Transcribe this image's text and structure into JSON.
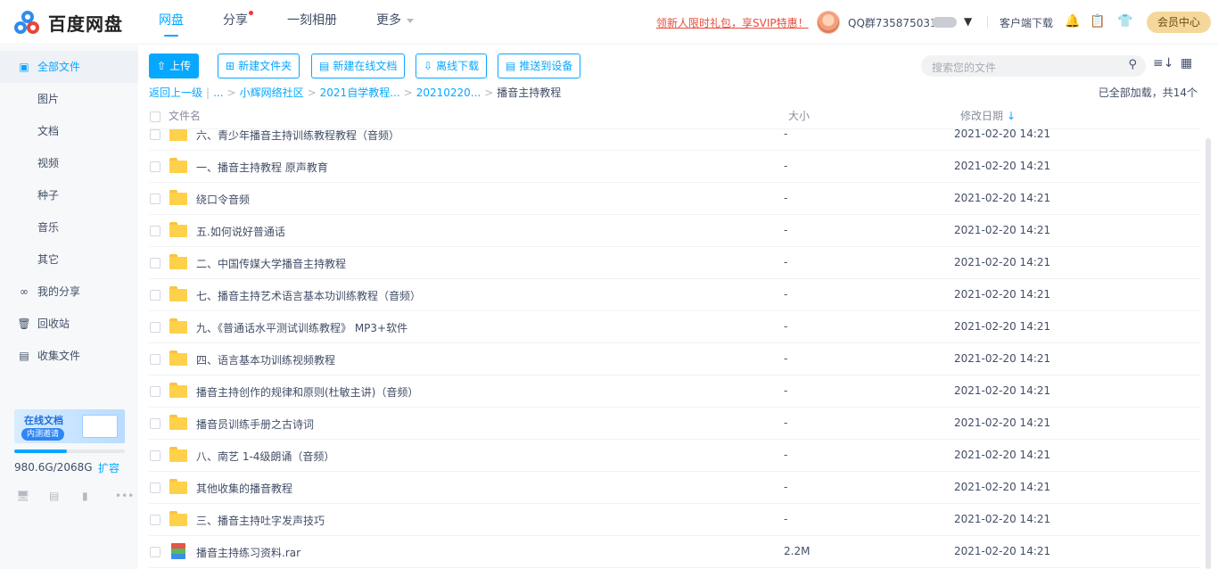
{
  "header": {
    "logo_text": "百度网盘",
    "nav": [
      {
        "label": "网盘",
        "active": true
      },
      {
        "label": "分享",
        "dot": true
      },
      {
        "label": "一刻相册"
      },
      {
        "label": "更多",
        "caret": true
      }
    ],
    "promo": "领新人限时礼包，享SVIP特惠！",
    "username": "QQ群735875031",
    "client_download": "客户端下载",
    "member_center": "会员中心"
  },
  "sidebar": {
    "items": [
      {
        "label": "全部文件",
        "icon": "file-icon",
        "active": true
      },
      {
        "label": "图片"
      },
      {
        "label": "文档"
      },
      {
        "label": "视频"
      },
      {
        "label": "种子"
      },
      {
        "label": "音乐"
      },
      {
        "label": "其它"
      },
      {
        "label": "我的分享",
        "icon": "share-icon"
      },
      {
        "label": "回收站",
        "icon": "trash-icon"
      },
      {
        "label": "收集文件",
        "icon": "collect-icon"
      }
    ],
    "banner": {
      "title": "在线文档",
      "badge": "内测邀请"
    },
    "quota": {
      "used_text": "980.6G/2068G",
      "used_fraction": 0.474,
      "expand": "扩容"
    }
  },
  "toolbar": {
    "upload": "上传",
    "new_folder": "新建文件夹",
    "new_doc": "新建在线文档",
    "offline_download": "离线下载",
    "push_device": "推送到设备",
    "search_placeholder": "搜索您的文件"
  },
  "breadcrumb": {
    "back": "返回上一级",
    "ellipsis": "...",
    "items": [
      "小辉网络社区",
      "2021自学教程...",
      "20210220..."
    ],
    "current": "播音主持教程"
  },
  "loaded_status": "已全部加载，共14个",
  "table": {
    "headers": {
      "name": "文件名",
      "size": "大小",
      "date": "修改日期"
    },
    "rows": [
      {
        "name": "六、青少年播音主持训练教程教程（音频）",
        "size": "-",
        "date": "2021-02-20 14:21",
        "type": "folder"
      },
      {
        "name": "一、播音主持教程 原声教育",
        "size": "-",
        "date": "2021-02-20 14:21",
        "type": "folder"
      },
      {
        "name": "绕口令音频",
        "size": "-",
        "date": "2021-02-20 14:21",
        "type": "folder"
      },
      {
        "name": "五.如何说好普通话",
        "size": "-",
        "date": "2021-02-20 14:21",
        "type": "folder"
      },
      {
        "name": "二、中国传媒大学播音主持教程",
        "size": "-",
        "date": "2021-02-20 14:21",
        "type": "folder"
      },
      {
        "name": "七、播音主持艺术语言基本功训练教程（音频）",
        "size": "-",
        "date": "2021-02-20 14:21",
        "type": "folder"
      },
      {
        "name": "九、《普通话水平测试训练教程》 MP3+软件",
        "size": "-",
        "date": "2021-02-20 14:21",
        "type": "folder"
      },
      {
        "name": "四、语言基本功训练视频教程",
        "size": "-",
        "date": "2021-02-20 14:21",
        "type": "folder"
      },
      {
        "name": "播音主持创作的规律和原则(杜敏主讲)（音频）",
        "size": "-",
        "date": "2021-02-20 14:21",
        "type": "folder"
      },
      {
        "name": "播音员训练手册之古诗词",
        "size": "-",
        "date": "2021-02-20 14:21",
        "type": "folder"
      },
      {
        "name": "八、南艺 1-4级朗诵（音频）",
        "size": "-",
        "date": "2021-02-20 14:21",
        "type": "folder"
      },
      {
        "name": "其他收集的播音教程",
        "size": "-",
        "date": "2021-02-20 14:21",
        "type": "folder"
      },
      {
        "name": "三、播音主持吐字发声技巧",
        "size": "-",
        "date": "2021-02-20 14:21",
        "type": "folder"
      },
      {
        "name": "播音主持练习资料.rar",
        "size": "2.2M",
        "date": "2021-02-20 14:21",
        "type": "rar"
      }
    ]
  }
}
